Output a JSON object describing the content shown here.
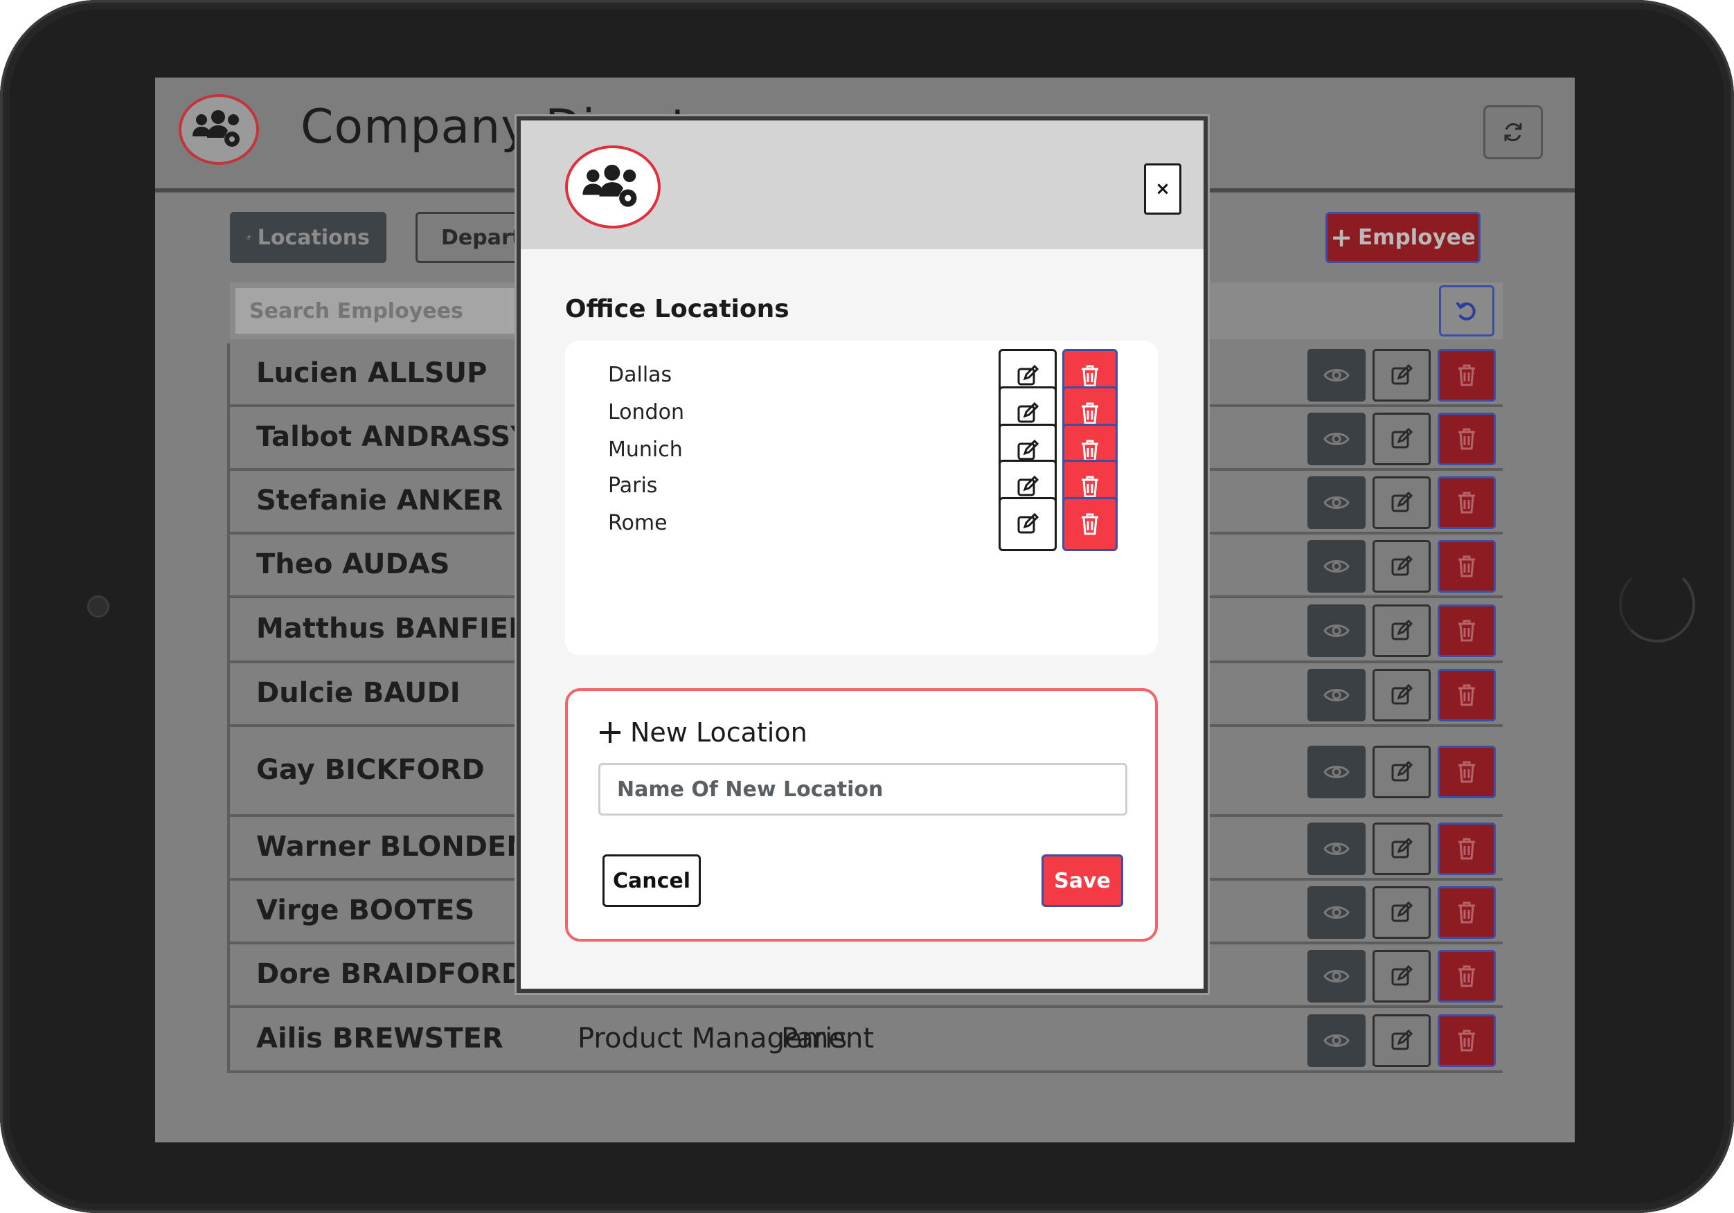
{
  "app": {
    "title": "Company Directory",
    "tabs": [
      {
        "label": "Locations"
      },
      {
        "label": "Departments"
      }
    ],
    "add_employee_label": "Employee",
    "search_placeholder": "Search Employees"
  },
  "employees": [
    {
      "name": "Lucien ALLSUP",
      "department": "",
      "location": ""
    },
    {
      "name": "Talbot ANDRASSY",
      "department": "",
      "location": ""
    },
    {
      "name": "Stefanie ANKER",
      "department": "",
      "location": ""
    },
    {
      "name": "Theo AUDAS",
      "department": "",
      "location": ""
    },
    {
      "name": "Matthus BANFIELD",
      "department": "",
      "location": ""
    },
    {
      "name": "Dulcie BAUDI",
      "department": "",
      "location": ""
    },
    {
      "name": "Gay BICKFORD",
      "department": "",
      "location": ""
    },
    {
      "name": "Warner BLONDEN",
      "department": "",
      "location": ""
    },
    {
      "name": "Virge BOOTES",
      "department": "",
      "location": ""
    },
    {
      "name": "Dore BRAIDFORD",
      "department": "",
      "location": ""
    },
    {
      "name": "Ailis BREWSTER",
      "department": "Product Management",
      "location": "Paris"
    }
  ],
  "modal": {
    "close_label": "×",
    "title": "Office Locations",
    "locations": [
      {
        "name": "Dallas"
      },
      {
        "name": "London"
      },
      {
        "name": "Munich"
      },
      {
        "name": "Paris"
      },
      {
        "name": "Rome"
      }
    ],
    "new_location": {
      "title": "New Location",
      "input_placeholder": "Name Of New Location",
      "input_value": "",
      "cancel_label": "Cancel",
      "save_label": "Save"
    }
  },
  "colors": {
    "accent_red": "#f43a45",
    "outline_blue": "#3d4fa3",
    "logo_ring": "#e0303c"
  },
  "icons": {
    "logo": "users-gear-icon",
    "refresh": "sync-icon",
    "edit": "edit-icon",
    "delete": "trash-icon",
    "view": "eye-icon",
    "reset": "undo-icon",
    "plus": "plus-icon"
  }
}
